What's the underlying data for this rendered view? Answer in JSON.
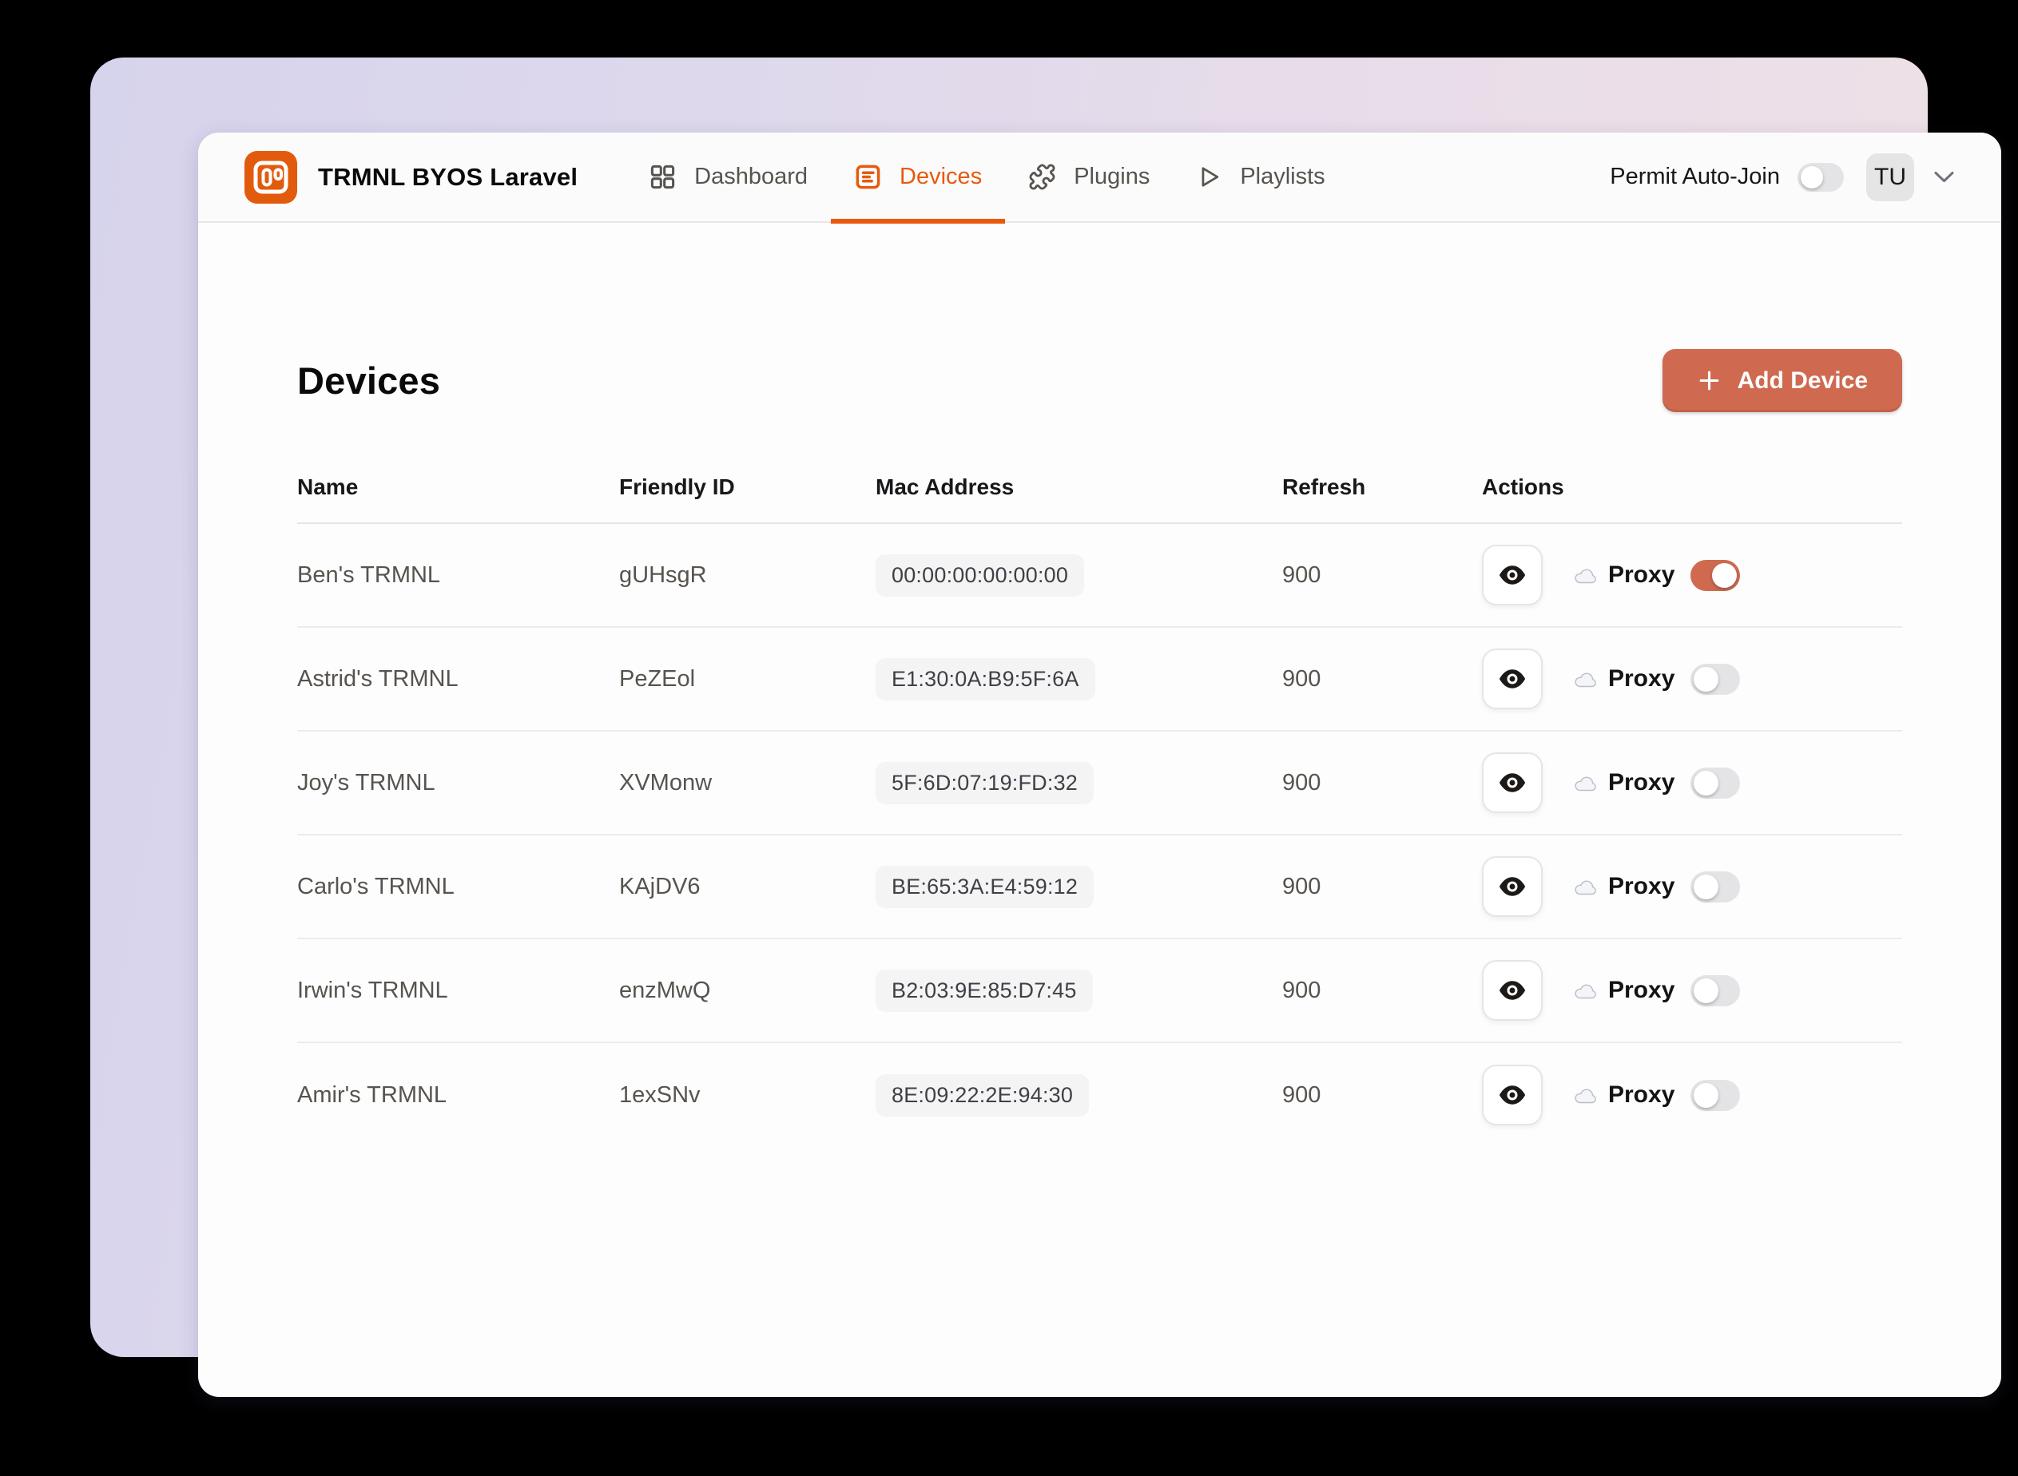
{
  "colors": {
    "accent": "#e8590c",
    "logo": "#e25b0d",
    "button": "#cf6a50",
    "toggle_off": "#e4e4e7",
    "badge_bg": "#f4f4f5"
  },
  "header": {
    "app_title": "TRMNL BYOS Laravel",
    "nav": [
      {
        "label": "Dashboard",
        "icon": "grid-icon",
        "active": false
      },
      {
        "label": "Devices",
        "icon": "list-icon",
        "active": true
      },
      {
        "label": "Plugins",
        "icon": "puzzle-icon",
        "active": false
      },
      {
        "label": "Playlists",
        "icon": "play-icon",
        "active": false
      }
    ],
    "permit_auto_join": {
      "label": "Permit Auto-Join",
      "enabled": false
    },
    "user": {
      "initials": "TU"
    }
  },
  "page": {
    "title": "Devices",
    "add_button_label": "Add Device"
  },
  "table": {
    "columns": [
      "Name",
      "Friendly ID",
      "Mac Address",
      "Refresh",
      "Actions"
    ],
    "rows": [
      {
        "name": "Ben's TRMNL",
        "friendly_id": "gUHsgR",
        "mac": "00:00:00:00:00:00",
        "refresh": "900",
        "proxy_label": "Proxy",
        "proxy_enabled": true
      },
      {
        "name": "Astrid's TRMNL",
        "friendly_id": "PeZEol",
        "mac": "E1:30:0A:B9:5F:6A",
        "refresh": "900",
        "proxy_label": "Proxy",
        "proxy_enabled": false
      },
      {
        "name": "Joy's TRMNL",
        "friendly_id": "XVMonw",
        "mac": "5F:6D:07:19:FD:32",
        "refresh": "900",
        "proxy_label": "Proxy",
        "proxy_enabled": false
      },
      {
        "name": "Carlo's TRMNL",
        "friendly_id": "KAjDV6",
        "mac": "BE:65:3A:E4:59:12",
        "refresh": "900",
        "proxy_label": "Proxy",
        "proxy_enabled": false
      },
      {
        "name": "Irwin's TRMNL",
        "friendly_id": "enzMwQ",
        "mac": "B2:03:9E:85:D7:45",
        "refresh": "900",
        "proxy_label": "Proxy",
        "proxy_enabled": false
      },
      {
        "name": "Amir's TRMNL",
        "friendly_id": "1exSNv",
        "mac": "8E:09:22:2E:94:30",
        "refresh": "900",
        "proxy_label": "Proxy",
        "proxy_enabled": false
      }
    ]
  }
}
